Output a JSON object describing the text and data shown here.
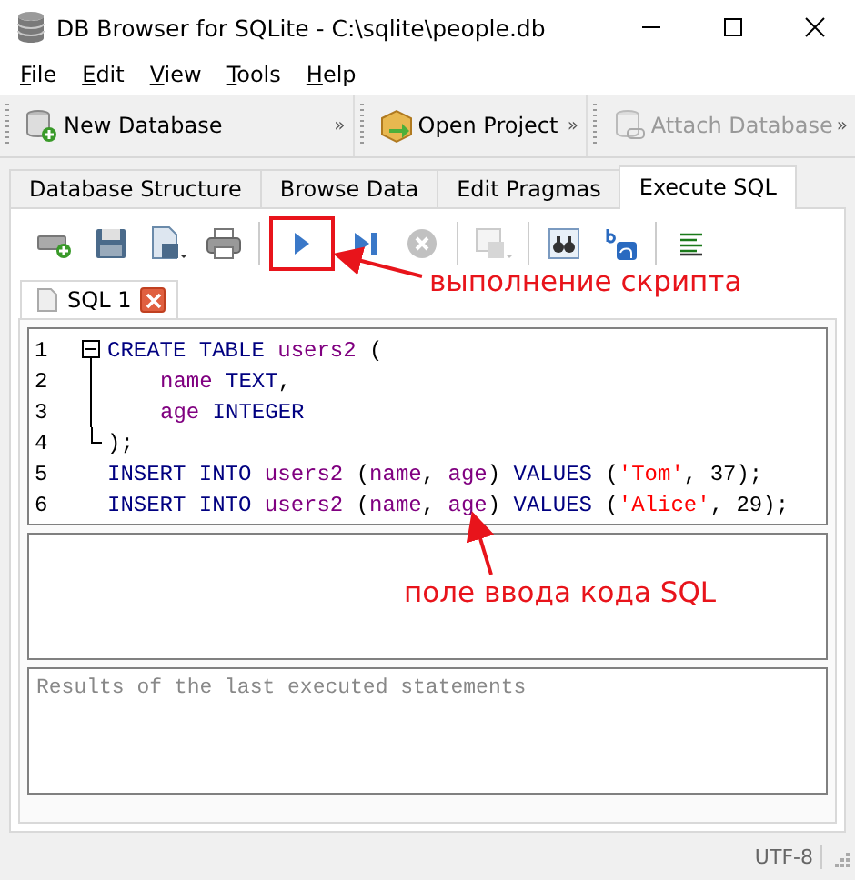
{
  "window": {
    "title": "DB Browser for SQLite - C:\\sqlite\\people.db"
  },
  "menu": [
    {
      "label": "File"
    },
    {
      "label": "Edit"
    },
    {
      "label": "View"
    },
    {
      "label": "Tools"
    },
    {
      "label": "Help"
    }
  ],
  "main_toolbar": [
    {
      "kind": "new-db",
      "label": "New Database",
      "overflow": "»",
      "disabled": false
    },
    {
      "kind": "open-project",
      "label": "Open Project",
      "overflow": "»",
      "disabled": false
    },
    {
      "kind": "attach",
      "label": "Attach Database",
      "overflow": "»",
      "disabled": true
    }
  ],
  "tabs": [
    {
      "label": "Database Structure",
      "selected": false
    },
    {
      "label": "Browse Data",
      "selected": false
    },
    {
      "label": "Edit Pragmas",
      "selected": false
    },
    {
      "label": "Execute SQL",
      "selected": true
    }
  ],
  "sql_toolbar": [
    {
      "kind": "open-tab",
      "disabled": false,
      "highlighted": false
    },
    {
      "kind": "save",
      "disabled": false,
      "highlighted": false
    },
    {
      "kind": "save-menu",
      "disabled": false,
      "highlighted": false
    },
    {
      "kind": "print",
      "disabled": false,
      "highlighted": false
    },
    {
      "kind": "separator"
    },
    {
      "kind": "run",
      "disabled": false,
      "highlighted": true
    },
    {
      "kind": "run-line",
      "disabled": false,
      "highlighted": false
    },
    {
      "kind": "stop",
      "disabled": true,
      "highlighted": false
    },
    {
      "kind": "separator"
    },
    {
      "kind": "save-results",
      "disabled": true,
      "highlighted": false
    },
    {
      "kind": "separator"
    },
    {
      "kind": "find",
      "disabled": false,
      "highlighted": false
    },
    {
      "kind": "replace",
      "disabled": false,
      "highlighted": false
    },
    {
      "kind": "separator"
    },
    {
      "kind": "comment",
      "disabled": false,
      "highlighted": false
    }
  ],
  "editor_tabs": [
    {
      "label": "SQL 1"
    }
  ],
  "code_lines": [
    {
      "number": "1",
      "kind": "fold-start",
      "indented": false,
      "tokens": [
        {
          "kind": "keyword",
          "text": "CREATE TABLE "
        },
        {
          "kind": "ident",
          "text": "users2"
        },
        {
          "kind": "punct",
          "text": " ("
        }
      ]
    },
    {
      "number": "2",
      "kind": "fold-inside",
      "indented": true,
      "tokens": [
        {
          "kind": "ident",
          "text": "name"
        },
        {
          "kind": "keyword",
          "text": " TEXT"
        },
        {
          "kind": "punct",
          "text": ","
        }
      ]
    },
    {
      "number": "3",
      "kind": "fold-inside",
      "indented": true,
      "tokens": [
        {
          "kind": "ident",
          "text": "age"
        },
        {
          "kind": "keyword",
          "text": " INTEGER"
        }
      ]
    },
    {
      "number": "4",
      "kind": "fold-end",
      "indented": false,
      "tokens": [
        {
          "kind": "punct",
          "text": ");"
        }
      ]
    },
    {
      "number": "5",
      "kind": "plain",
      "indented": false,
      "tokens": [
        {
          "kind": "keyword",
          "text": "INSERT INTO "
        },
        {
          "kind": "ident",
          "text": "users2"
        },
        {
          "kind": "punct",
          "text": " ("
        },
        {
          "kind": "ident",
          "text": "name"
        },
        {
          "kind": "punct",
          "text": ", "
        },
        {
          "kind": "ident",
          "text": "age"
        },
        {
          "kind": "punct",
          "text": ") "
        },
        {
          "kind": "keyword",
          "text": "VALUES"
        },
        {
          "kind": "punct",
          "text": " ("
        },
        {
          "kind": "string",
          "text": "'Tom'"
        },
        {
          "kind": "punct",
          "text": ", 37);"
        }
      ]
    },
    {
      "number": "6",
      "kind": "plain",
      "indented": false,
      "tokens": [
        {
          "kind": "keyword",
          "text": "INSERT INTO "
        },
        {
          "kind": "ident",
          "text": "users2"
        },
        {
          "kind": "punct",
          "text": " ("
        },
        {
          "kind": "ident",
          "text": "name"
        },
        {
          "kind": "punct",
          "text": ", "
        },
        {
          "kind": "ident",
          "text": "age"
        },
        {
          "kind": "punct",
          "text": ") "
        },
        {
          "kind": "keyword",
          "text": "VALUES"
        },
        {
          "kind": "punct",
          "text": " ("
        },
        {
          "kind": "string",
          "text": "'Alice'"
        },
        {
          "kind": "punct",
          "text": ", 29);"
        }
      ]
    }
  ],
  "message_box": {
    "placeholder": "Results of the last executed statements"
  },
  "annotations": [
    {
      "kind": "run",
      "text": "выполнение скрипта"
    },
    {
      "kind": "editor",
      "text": "поле ввода кода SQL"
    }
  ],
  "status_bar": {
    "encoding": "UTF-8"
  }
}
